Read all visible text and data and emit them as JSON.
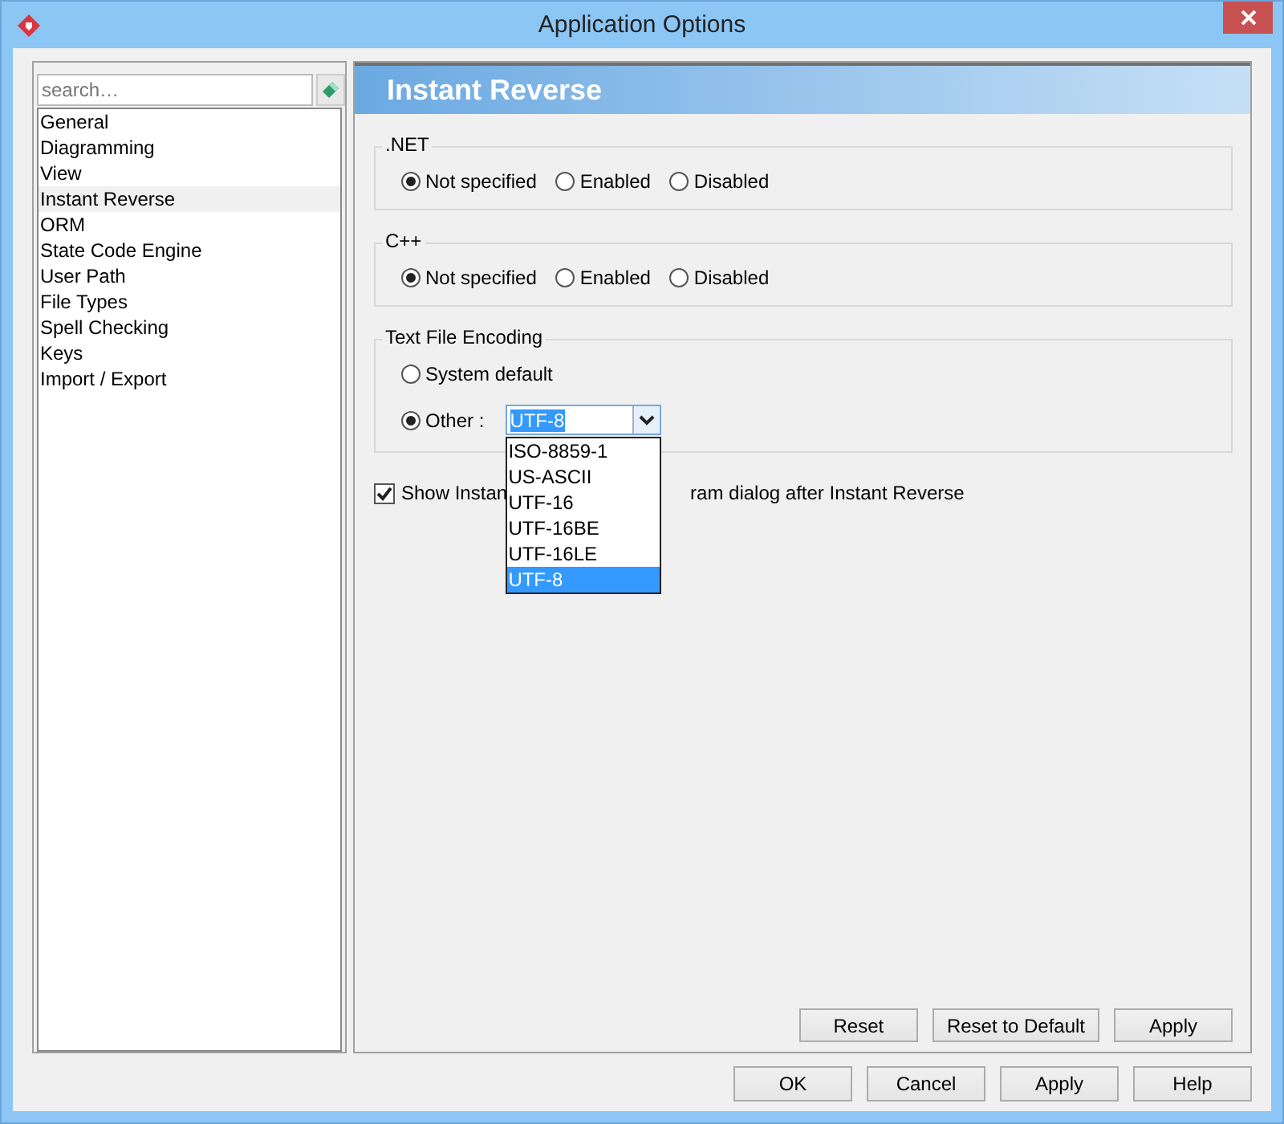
{
  "window": {
    "title": "Application Options"
  },
  "sidebar": {
    "search": {
      "placeholder": "search…"
    },
    "items": [
      {
        "label": "General",
        "selected": false
      },
      {
        "label": "Diagramming",
        "selected": false
      },
      {
        "label": "View",
        "selected": false
      },
      {
        "label": "Instant Reverse",
        "selected": true
      },
      {
        "label": "ORM",
        "selected": false
      },
      {
        "label": "State Code Engine",
        "selected": false
      },
      {
        "label": "User Path",
        "selected": false
      },
      {
        "label": "File Types",
        "selected": false
      },
      {
        "label": "Spell Checking",
        "selected": false
      },
      {
        "label": "Keys",
        "selected": false
      },
      {
        "label": "Import / Export",
        "selected": false
      }
    ]
  },
  "panel": {
    "title": "Instant Reverse",
    "groups": [
      {
        "title": ".NET",
        "kind": "row",
        "options": [
          {
            "label": "Not specified",
            "selected": true
          },
          {
            "label": "Enabled",
            "selected": false
          },
          {
            "label": "Disabled",
            "selected": false
          }
        ]
      },
      {
        "title": "C++",
        "kind": "row",
        "options": [
          {
            "label": "Not specified",
            "selected": true
          },
          {
            "label": "Enabled",
            "selected": false
          },
          {
            "label": "Disabled",
            "selected": false
          }
        ]
      },
      {
        "title": "Text File Encoding",
        "kind": "encoding",
        "options": [
          {
            "label": "System default",
            "selected": false
          },
          {
            "label": "Other :",
            "selected": true
          }
        ],
        "combo": {
          "value": "UTF-8",
          "list": [
            {
              "label": "ISO-8859-1",
              "selected": false
            },
            {
              "label": "US-ASCII",
              "selected": false
            },
            {
              "label": "UTF-16",
              "selected": false
            },
            {
              "label": "UTF-16BE",
              "selected": false
            },
            {
              "label": "UTF-16LE",
              "selected": false
            },
            {
              "label": "UTF-8",
              "selected": true
            }
          ]
        }
      }
    ],
    "checkbox": {
      "label_parts": [
        "Show Instan",
        "ram dialog after Instant Reverse"
      ],
      "checked": true
    },
    "buttons": [
      "Reset",
      "Reset to Default",
      "Apply"
    ]
  },
  "buttons": [
    "OK",
    "Cancel",
    "Apply",
    "Help"
  ]
}
